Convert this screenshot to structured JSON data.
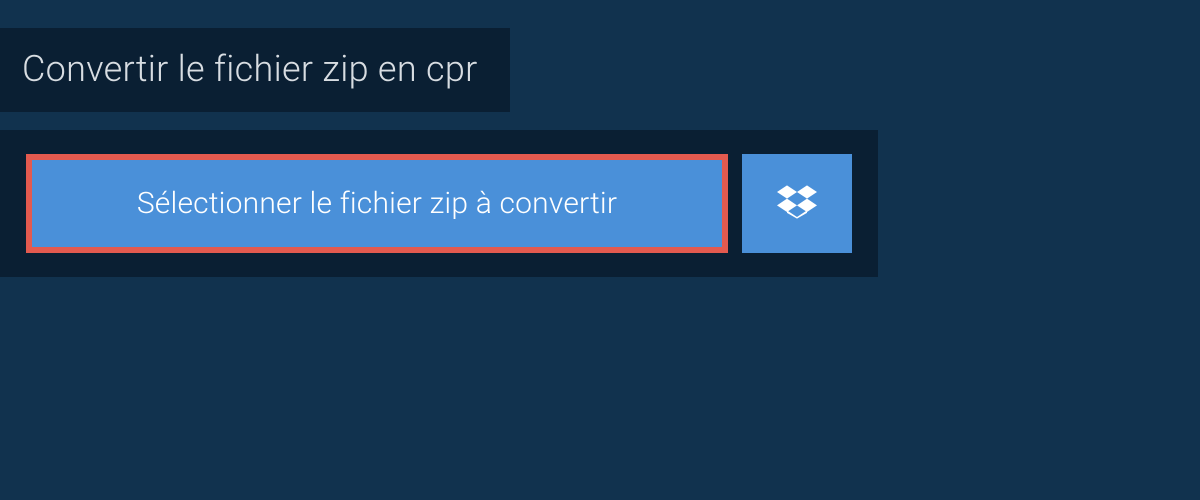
{
  "header": {
    "title": "Convertir le fichier zip en cpr"
  },
  "upload": {
    "select_label": "Sélectionner le fichier zip à convertir",
    "dropbox_icon": "dropbox"
  },
  "colors": {
    "background": "#11324e",
    "panel": "#0a1f33",
    "button": "#4a90d9",
    "highlight_border": "#e35a4f",
    "text_light": "#d8dde2",
    "text_white": "#ffffff"
  }
}
